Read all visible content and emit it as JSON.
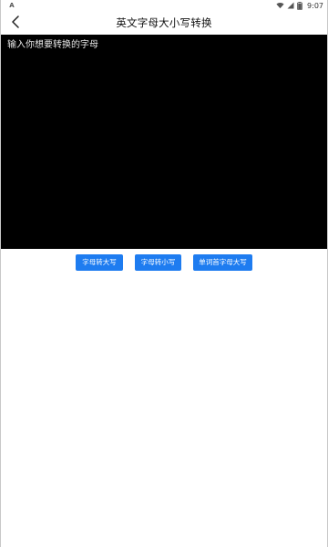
{
  "status_bar": {
    "notification_icon": "A",
    "time": "9:07",
    "icons": [
      "wifi-icon",
      "signal-icon",
      "battery-icon"
    ]
  },
  "header": {
    "title": "英文字母大小写转换",
    "back_icon": "chevron-left-icon"
  },
  "input": {
    "value": "",
    "placeholder": "输入你想要转换的字母"
  },
  "buttons": {
    "to_upper": "字母转大写",
    "to_lower": "字母转小写",
    "capitalize": "单词首字母大写"
  },
  "colors": {
    "accent": "#1e7cf0",
    "input_bg": "#000000"
  }
}
